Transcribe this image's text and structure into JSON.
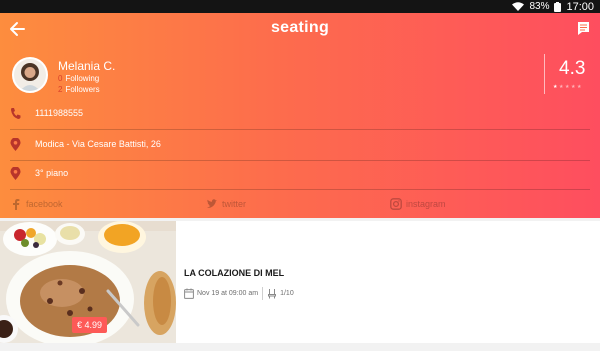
{
  "status_bar": {
    "battery": "83%",
    "time": "17:00"
  },
  "header": {
    "brand": "seating"
  },
  "profile": {
    "name": "Melania C.",
    "following_count": "0",
    "following_label": "Following",
    "followers_count": "2",
    "followers_label": "Followers",
    "rating": "4.3",
    "rating_value": 4.3,
    "rating_max": 5
  },
  "contact": {
    "phone": "1111988555",
    "address": "Modica - Via Cesare Battisti, 26",
    "floor": "3° piano"
  },
  "social": {
    "facebook": "facebook",
    "twitter": "twitter",
    "instagram": "instagram"
  },
  "event": {
    "title": "LA COLAZIONE DI MEL",
    "date": "Nov 19 at 09:00 am",
    "seats": "1/10",
    "price": "€ 4.99"
  },
  "colors": {
    "gradient_start": "#fd8d3e",
    "gradient_end": "#fe4e5f",
    "accent": "#d9402a",
    "price_badge": "#fd5a57"
  }
}
